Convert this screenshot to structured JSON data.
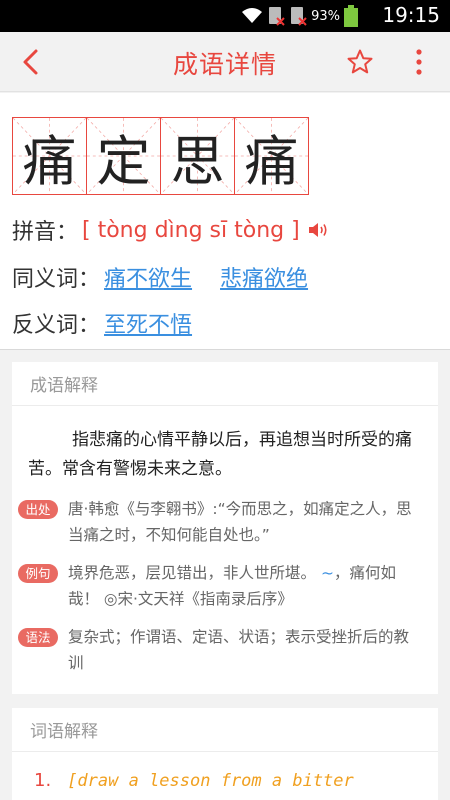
{
  "status_bar": {
    "battery_percent": "93%",
    "time": "19:15"
  },
  "app_bar": {
    "title": "成语详情",
    "icons": [
      "back-arrow-icon",
      "star-icon",
      "more-vertical-icon"
    ],
    "accent_color": "#e8473f"
  },
  "idiom": {
    "characters": [
      "痛",
      "定",
      "思",
      "痛"
    ],
    "pinyin_label": "拼音：",
    "pinyin": "[ tòng dìng sī tòng ]",
    "synonyms_label": "同义词：",
    "synonyms": [
      "痛不欲生",
      "悲痛欲绝"
    ],
    "antonyms_label": "反义词：",
    "antonyms": [
      "至死不悟"
    ]
  },
  "explanation_card": {
    "header": "成语解释",
    "text": "指悲痛的心情平静以后，再追想当时所受的痛苦。常含有警惕未来之意。",
    "source_tag": "出处",
    "source_text": "唐·韩愈《与李翱书》:“今而思之，如痛定之人，思当痛之时，不知何能自处也。”",
    "example_tag": "例句",
    "example_before": "境界危恶，层见错出，非人世所堪。",
    "example_tilde": "~",
    "example_after": "，痛何如哉！ ◎宋·文天祥《指南录后序》",
    "grammar_tag": "语法",
    "grammar_text": "复杂式；作谓语、定语、状语；表示受挫折后的教训"
  },
  "word_card": {
    "header": "词语解释",
    "items": [
      {
        "num": "1.",
        "text": "[draw a lesson from a bitter"
      }
    ]
  }
}
